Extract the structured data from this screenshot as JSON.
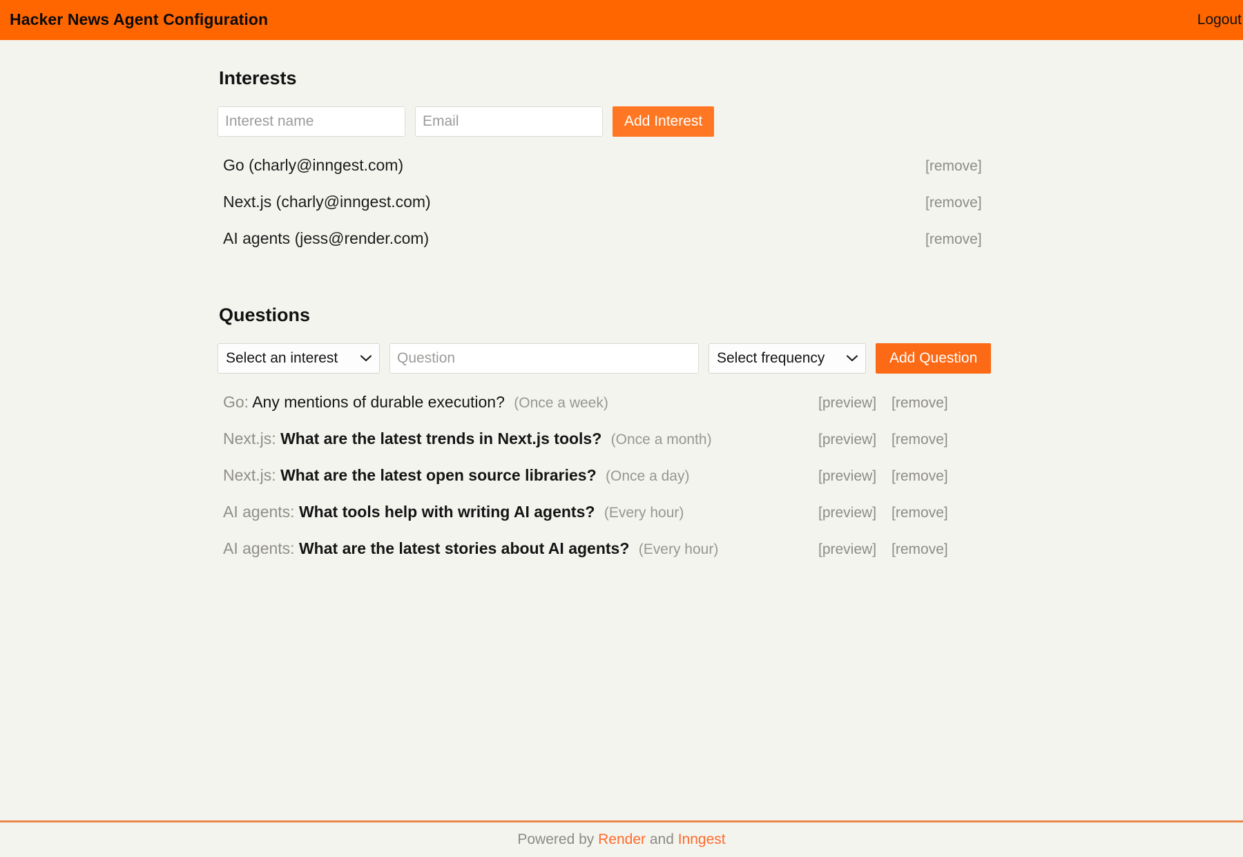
{
  "header": {
    "title": "Hacker News Agent Configuration",
    "logout_label": "Logout",
    "brand_color": "#ff6600"
  },
  "interests": {
    "section_title": "Interests",
    "form": {
      "name_placeholder": "Interest name",
      "name_value": "",
      "email_placeholder": "Email",
      "email_value": "",
      "add_label": "Add Interest"
    },
    "remove_label": "[remove]",
    "items": [
      {
        "label": "Go (charly@inngest.com)",
        "name": "Go",
        "email": "charly@inngest.com"
      },
      {
        "label": "Next.js (charly@inngest.com)",
        "name": "Next.js",
        "email": "charly@inngest.com"
      },
      {
        "label": "AI agents (jess@render.com)",
        "name": "AI agents",
        "email": "jess@render.com"
      }
    ]
  },
  "questions": {
    "section_title": "Questions",
    "form": {
      "interest_select_value": "Select an interest",
      "question_placeholder": "Question",
      "question_value": "",
      "frequency_select_value": "Select frequency",
      "add_label": "Add Question"
    },
    "preview_label": "[preview]",
    "remove_label": "[remove]",
    "items": [
      {
        "interest": "Go:",
        "text": "Any mentions of durable execution?",
        "frequency": "(Once a week)"
      },
      {
        "interest": "Next.js:",
        "text": "What are the latest trends in Next.js tools?",
        "frequency": "(Once a month)"
      },
      {
        "interest": "Next.js:",
        "text": "What are the latest open source libraries?",
        "frequency": "(Once a day)"
      },
      {
        "interest": "AI agents:",
        "text": "What tools help with writing AI agents?",
        "frequency": "(Every hour)"
      },
      {
        "interest": "AI agents:",
        "text": "What are the latest stories about AI agents?",
        "frequency": "(Every hour)"
      }
    ]
  },
  "footer": {
    "prefix": "Powered by ",
    "link1": "Render",
    "middle": " and ",
    "link2": "Inngest",
    "accent_color": "#ff6a2b",
    "divider_color": "#e8874a"
  }
}
